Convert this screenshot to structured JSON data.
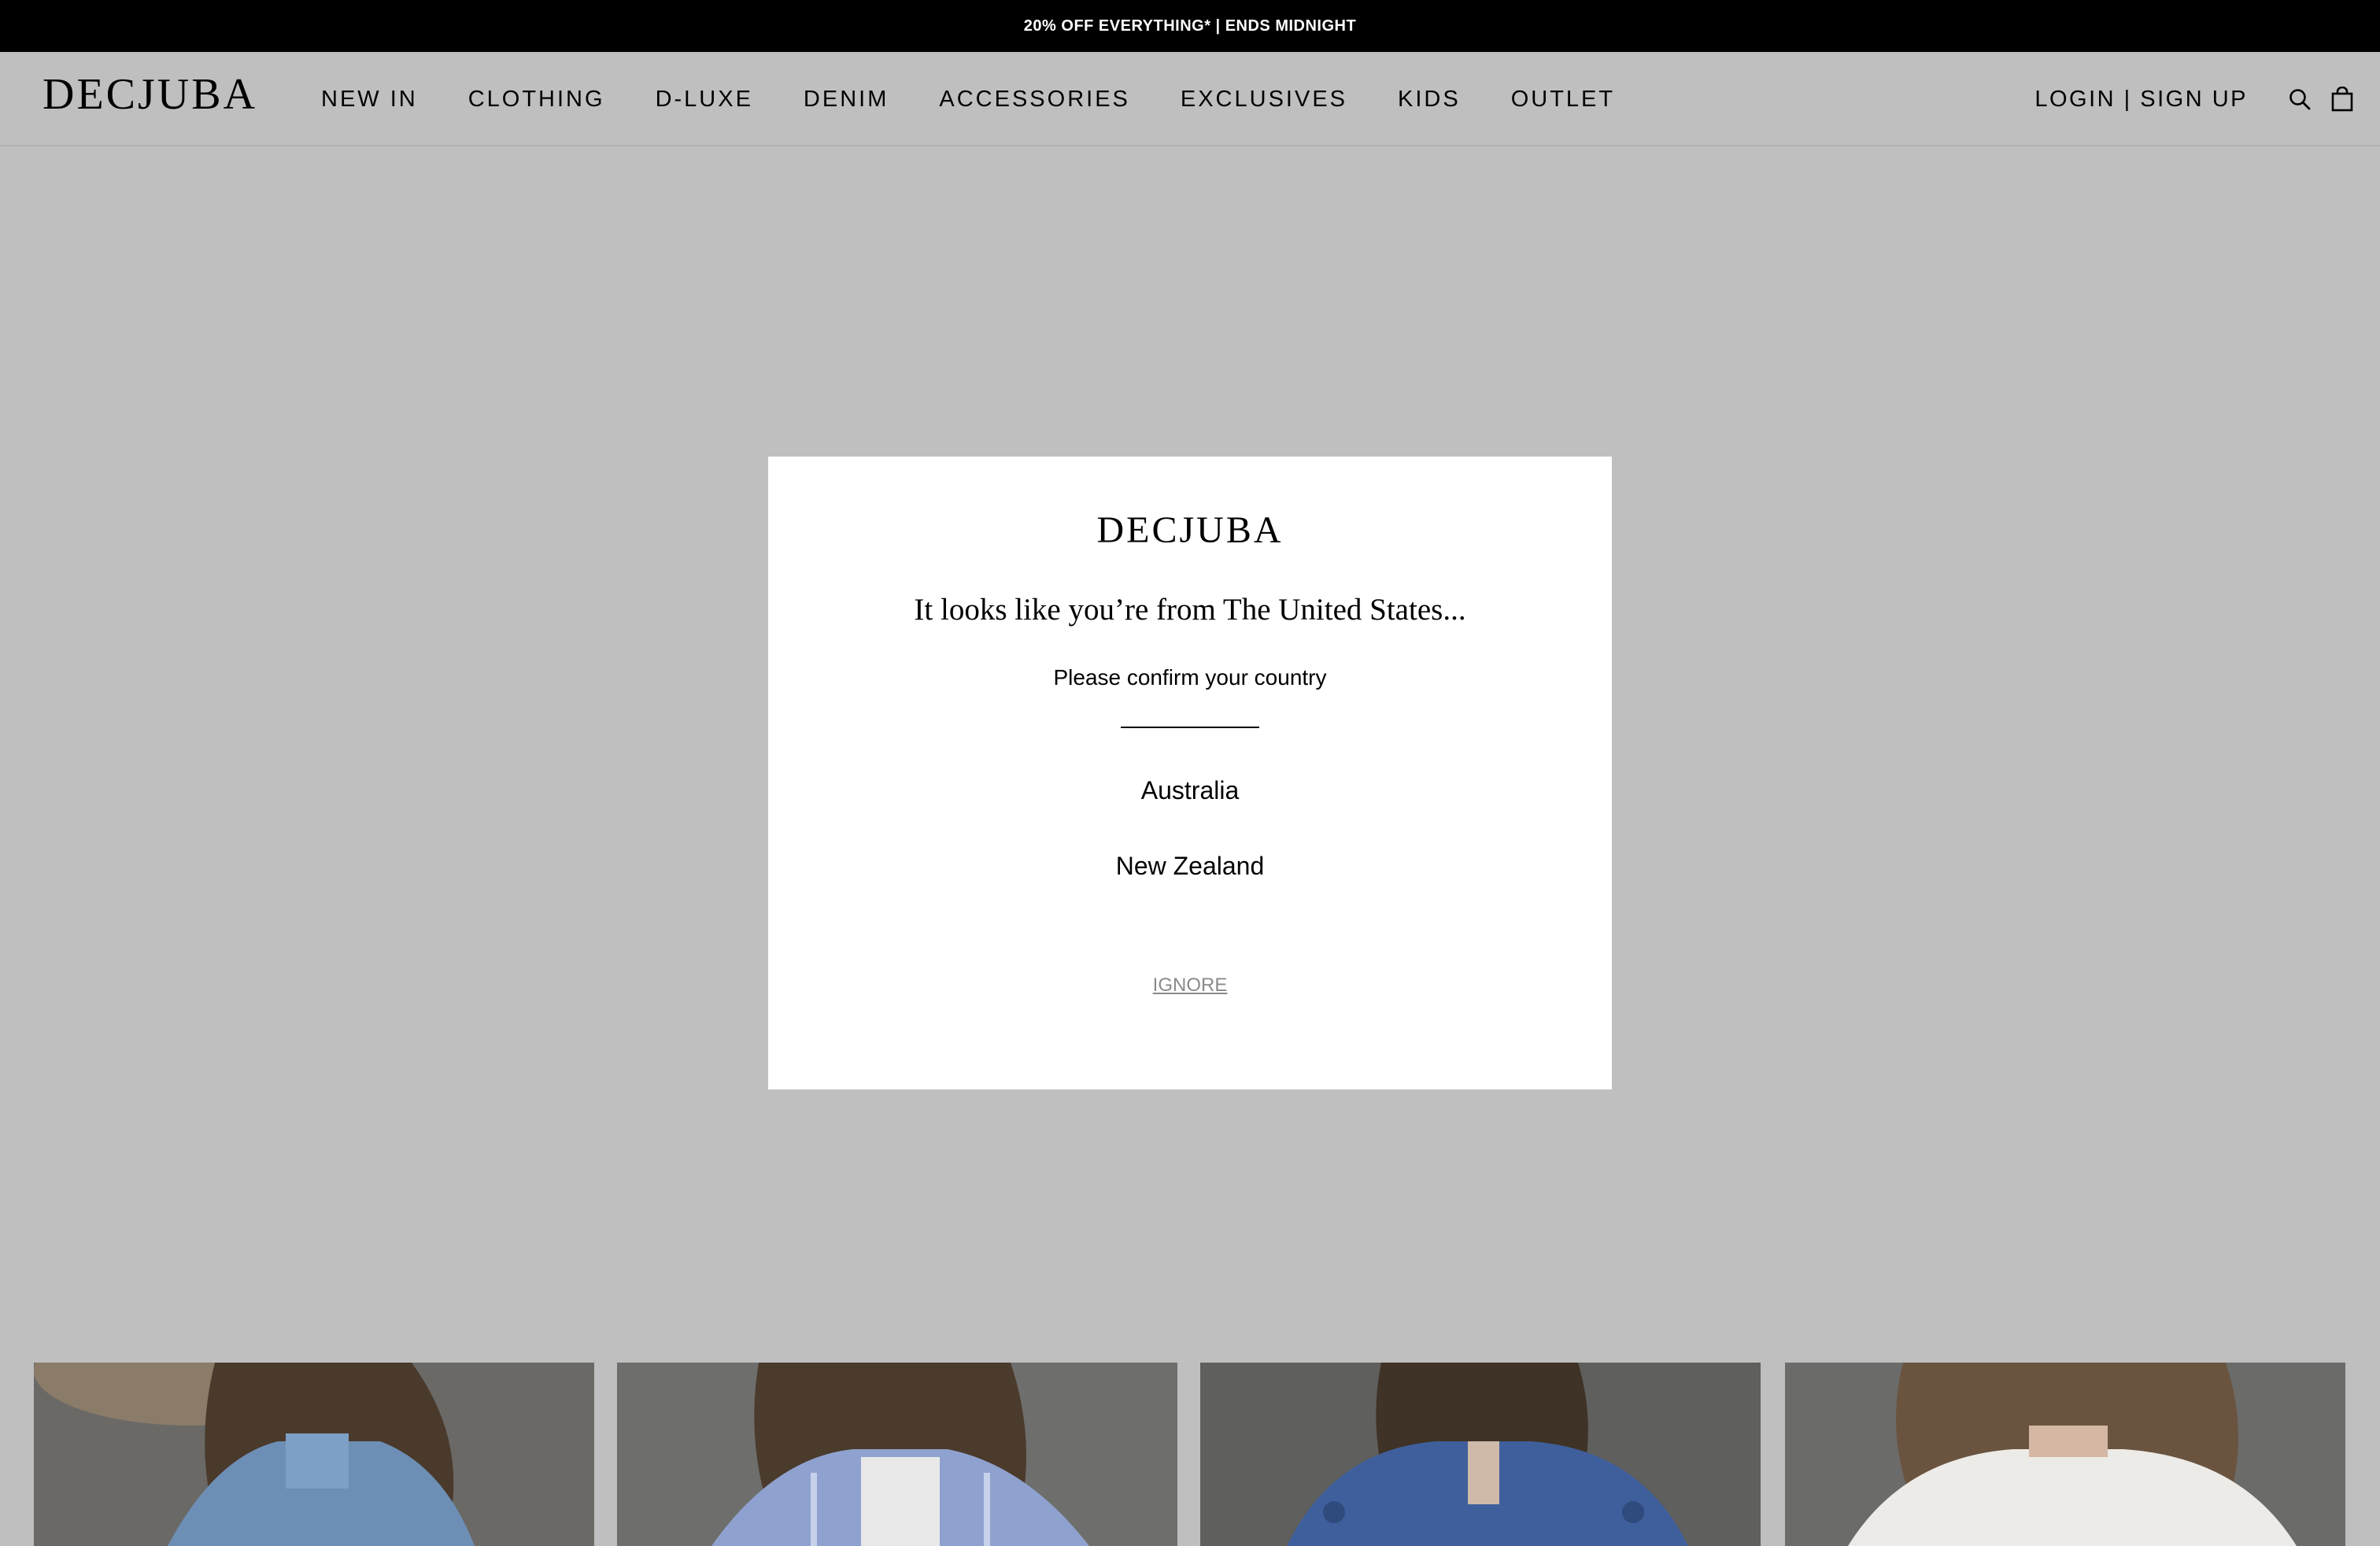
{
  "announcement": "20% OFF EVERYTHING* | ENDS MIDNIGHT",
  "brand": "DECJUBA",
  "nav": {
    "items": [
      "NEW IN",
      "CLOTHING",
      "D-LUXE",
      "DENIM",
      "ACCESSORIES",
      "EXCLUSIVES",
      "KIDS",
      "OUTLET"
    ]
  },
  "account": {
    "label": "LOGIN | SIGN UP"
  },
  "icons": {
    "search": "search-icon",
    "bag": "shopping-bag-icon"
  },
  "modal": {
    "brand": "DECJUBA",
    "heading": "It looks like you’re from The United States...",
    "subheading": "Please confirm your country",
    "options": [
      "Australia",
      "New Zealand"
    ],
    "ignore": "IGNORE"
  },
  "colors": {
    "overlay": "#bfbfbf",
    "announcement_bg": "#000000",
    "modal_bg": "#ffffff",
    "ignore_text": "#8a8a8a"
  }
}
